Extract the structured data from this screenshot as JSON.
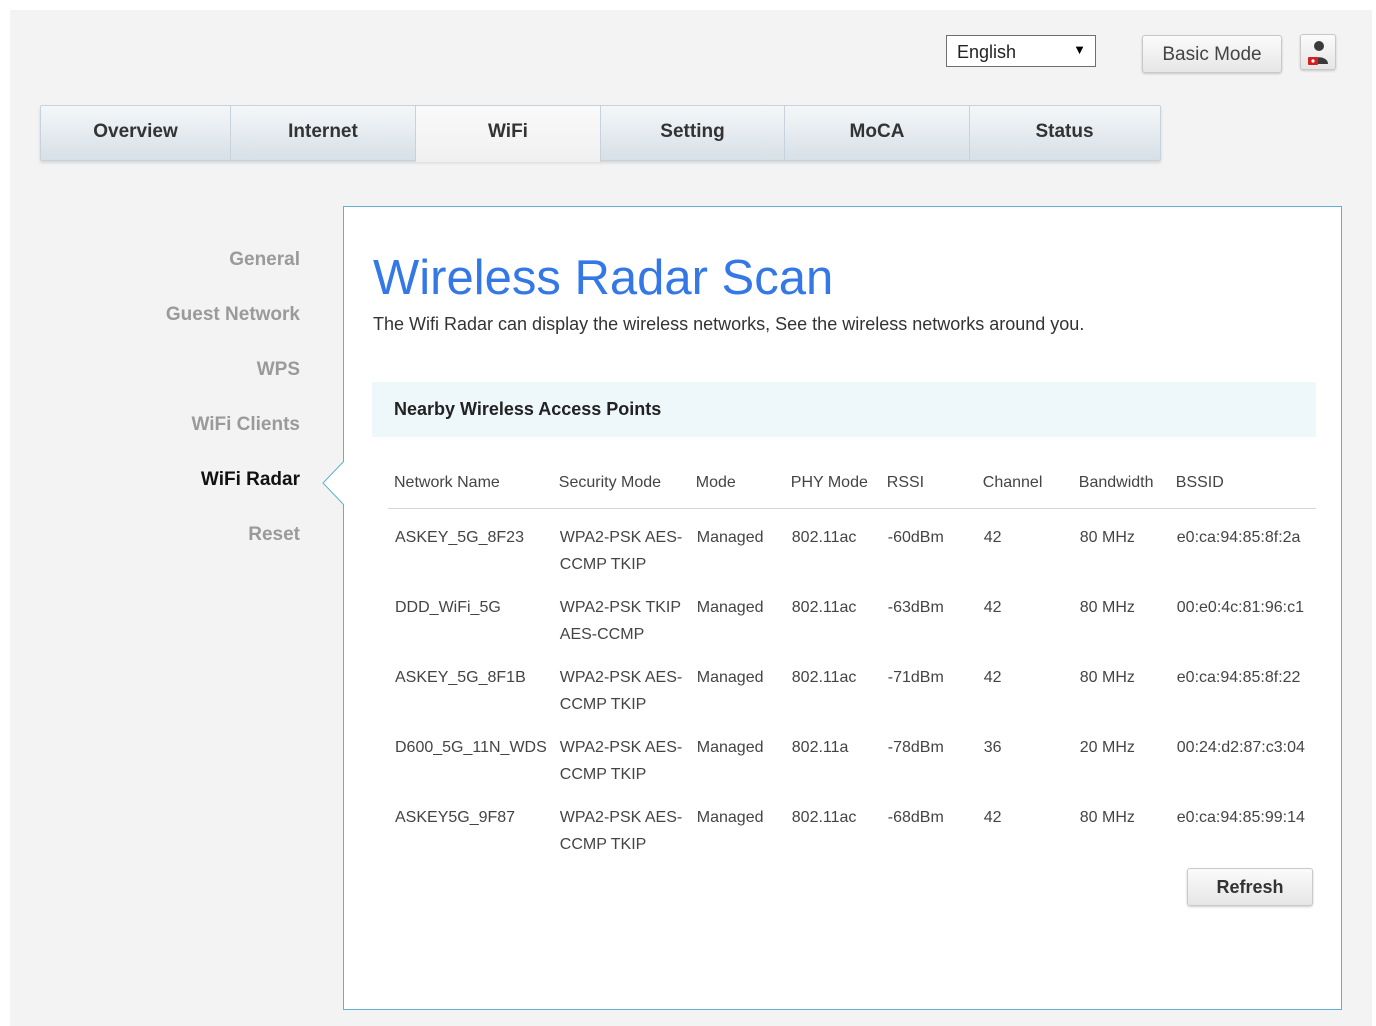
{
  "header": {
    "language_selected": "English",
    "basic_mode_label": "Basic Mode",
    "user_icon": "user-icon"
  },
  "nav": {
    "tabs": [
      {
        "label": "Overview"
      },
      {
        "label": "Internet"
      },
      {
        "label": "WiFi"
      },
      {
        "label": "Setting"
      },
      {
        "label": "MoCA"
      },
      {
        "label": "Status"
      }
    ],
    "active": "WiFi"
  },
  "sidebar": {
    "items": [
      {
        "label": "General"
      },
      {
        "label": "Guest Network"
      },
      {
        "label": "WPS"
      },
      {
        "label": "WiFi Clients"
      },
      {
        "label": "WiFi Radar"
      },
      {
        "label": "Reset"
      }
    ],
    "active": "WiFi Radar"
  },
  "main": {
    "title": "Wireless Radar Scan",
    "description": "The Wifi Radar can display the wireless networks, See the wireless networks around you.",
    "section_title": "Nearby Wireless Access Points",
    "columns": [
      "Network Name",
      "Security Mode",
      "Mode",
      "PHY Mode",
      "RSSI",
      "Channel",
      "Bandwidth",
      "BSSID"
    ],
    "rows": [
      [
        "ASKEY_5G_8F23",
        "WPA2-PSK AES-CCMP TKIP",
        "Managed",
        "802.11ac",
        "-60dBm",
        "42",
        "80 MHz",
        "e0:ca:94:85:8f:2a"
      ],
      [
        "DDD_WiFi_5G",
        "WPA2-PSK TKIP AES-CCMP",
        "Managed",
        "802.11ac",
        "-63dBm",
        "42",
        "80 MHz",
        "00:e0:4c:81:96:c1"
      ],
      [
        "ASKEY_5G_8F1B",
        "WPA2-PSK AES-CCMP TKIP",
        "Managed",
        "802.11ac",
        "-71dBm",
        "42",
        "80 MHz",
        "e0:ca:94:85:8f:22"
      ],
      [
        "D600_5G_11N_WDS",
        "WPA2-PSK AES-CCMP TKIP",
        "Managed",
        "802.11a",
        "-78dBm",
        "36",
        "20 MHz",
        "00:24:d2:87:c3:04"
      ],
      [
        "ASKEY5G_9F87",
        "WPA2-PSK AES-CCMP TKIP",
        "Managed",
        "802.11ac",
        "-68dBm",
        "42",
        "80 MHz",
        "e0:ca:94:85:99:14"
      ]
    ],
    "refresh_label": "Refresh"
  },
  "colors": {
    "title_blue": "#3478e8",
    "panel_border": "#5fb0cf",
    "section_bg": "#eef8fa"
  }
}
